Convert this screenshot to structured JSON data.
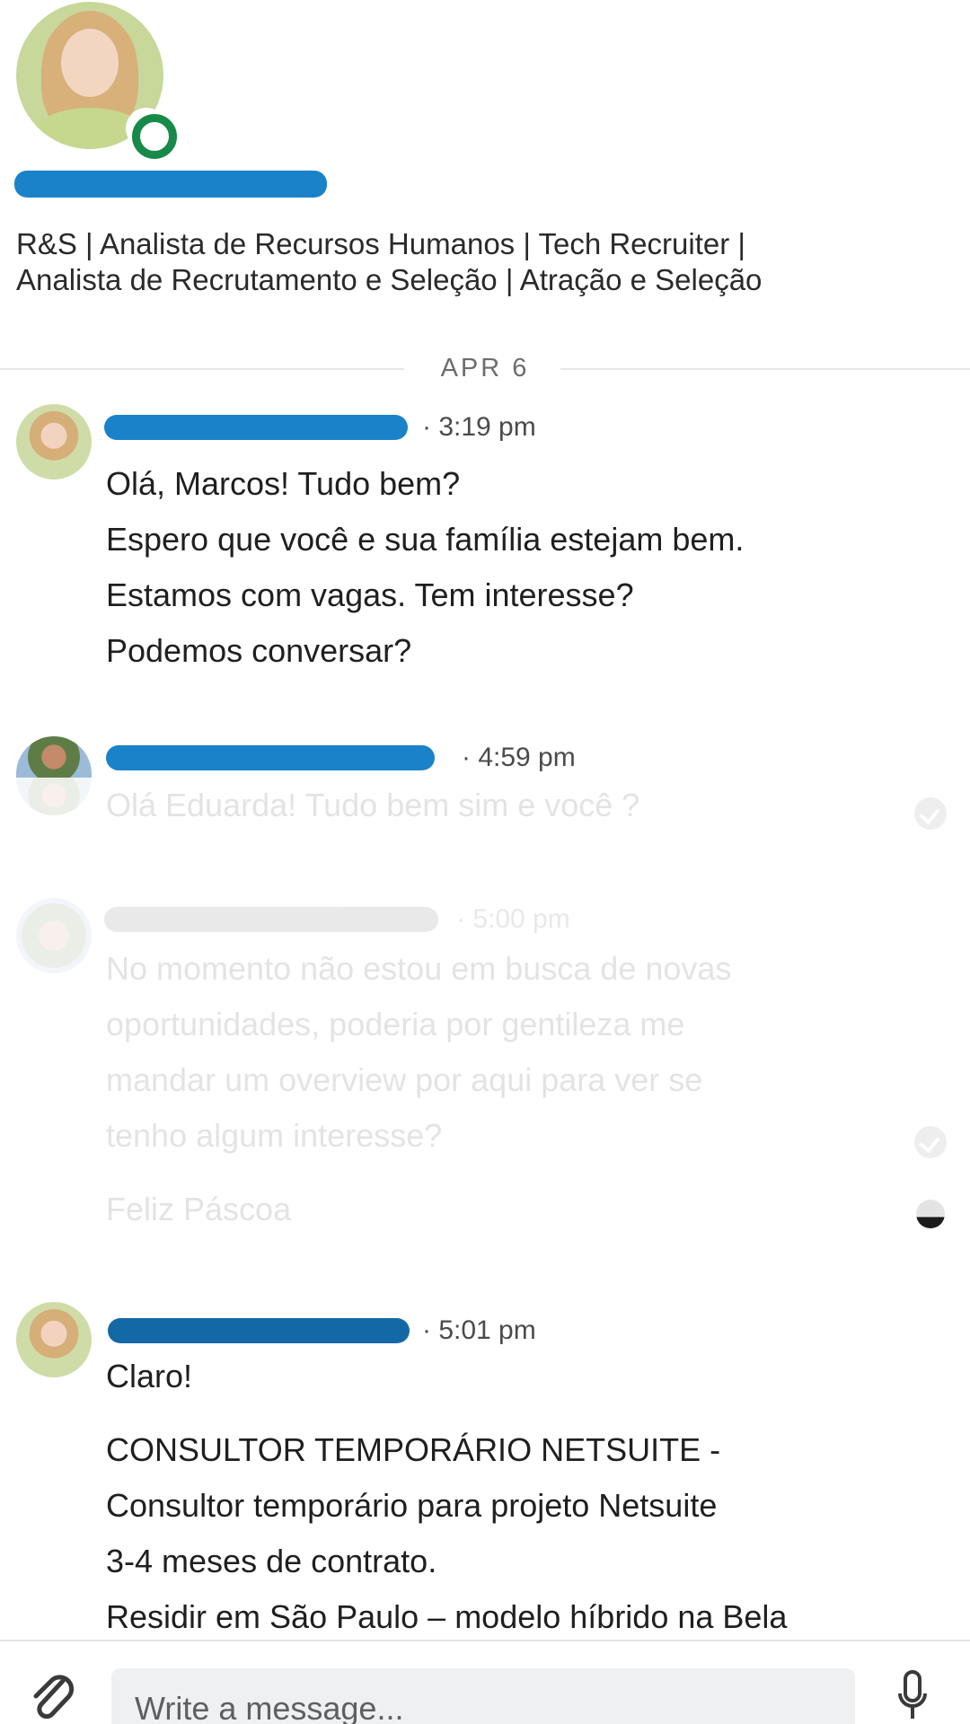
{
  "profile": {
    "headline_line1": "R&S | Analista de Recursos Humanos | Tech Recruiter |",
    "headline_line2": "Analista de Recrutamento e Seleção | Atração e Seleção"
  },
  "divider": {
    "date": "APR 6"
  },
  "messages": [
    {
      "time": "· 3:19 pm",
      "lines": [
        "Olá, Marcos! Tudo bem?",
        "Espero que você e sua família estejam bem.",
        "Estamos com vagas. Tem interesse?",
        "Podemos conversar?"
      ]
    },
    {
      "time": "· 4:59 pm",
      "lines": [
        "Olá Eduarda! Tudo bem sim e você ?"
      ]
    },
    {
      "time": "· 5:00 pm",
      "lines": [
        "No momento não estou em busca de novas",
        "oportunidades, poderia por gentileza me",
        "mandar um overview por aqui para ver se",
        "tenho algum interesse?"
      ],
      "extra": "Feliz Páscoa"
    },
    {
      "time": "· 5:01 pm",
      "lines": [
        "Claro!",
        "",
        "CONSULTOR TEMPORÁRIO NETSUITE -",
        "Consultor temporário para projeto Netsuite",
        "3-4 meses de contrato.",
        "Residir em São Paulo – modelo híbrido na Bela"
      ]
    }
  ],
  "composer": {
    "placeholder": "Write a message..."
  },
  "colors": {
    "redaction": "#1a82c9",
    "online": "#178a4a",
    "input_bg": "#eef0f1"
  }
}
